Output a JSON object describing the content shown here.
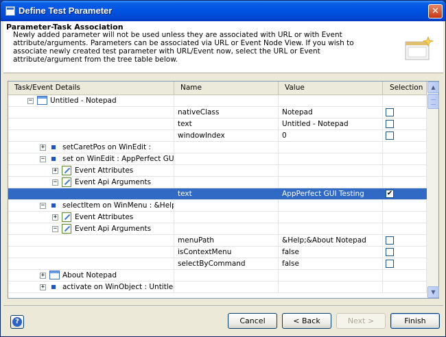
{
  "window": {
    "title": "Define Test Parameter",
    "close_glyph": "✕"
  },
  "header": {
    "title": "Parameter-Task Association",
    "description": "Newly added parameter will not be used unless they are associated with URL or with Event attribute/arguments. Parameters can be associated via URL or Event Node View. If you wish to associate newly created test parameter with URL/Event now, select the URL or Event attribute/argument from the tree table below.",
    "image_icon": "wizard-window-icon"
  },
  "table": {
    "columns": [
      "Task/Event Details",
      "Name",
      "Value",
      "Selection"
    ],
    "rows": [
      {
        "indent": 0,
        "toggle": "−",
        "icon": "window-icon",
        "task": "Untitled - Notepad",
        "name": "",
        "value": "",
        "checkbox": false,
        "checked": false,
        "selected": false
      },
      {
        "indent": -1,
        "toggle": "",
        "icon": "",
        "task": "",
        "name": "nativeClass",
        "value": "Notepad",
        "checkbox": true,
        "checked": false,
        "selected": false
      },
      {
        "indent": -1,
        "toggle": "",
        "icon": "",
        "task": "",
        "name": "text",
        "value": "Untitled - Notepad",
        "checkbox": true,
        "checked": false,
        "selected": false
      },
      {
        "indent": -1,
        "toggle": "",
        "icon": "",
        "task": "",
        "name": "windowIndex",
        "value": "0",
        "checkbox": true,
        "checked": false,
        "selected": false
      },
      {
        "indent": 1,
        "toggle": "+",
        "icon": "event-icon",
        "task": "setCaretPos on WinEdit :",
        "name": "",
        "value": "",
        "checkbox": false,
        "checked": false,
        "selected": false
      },
      {
        "indent": 1,
        "toggle": "−",
        "icon": "event-icon",
        "task": "set on WinEdit : AppPerfect GUI T",
        "name": "",
        "value": "",
        "checkbox": false,
        "checked": false,
        "selected": false
      },
      {
        "indent": 2,
        "toggle": "+",
        "icon": "edit-icon",
        "task": "Event Attributes",
        "name": "",
        "value": "",
        "checkbox": false,
        "checked": false,
        "selected": false
      },
      {
        "indent": 2,
        "toggle": "−",
        "icon": "edit-icon",
        "task": "Event Api Arguments",
        "name": "",
        "value": "",
        "checkbox": false,
        "checked": false,
        "selected": false
      },
      {
        "indent": -1,
        "toggle": "",
        "icon": "",
        "task": "",
        "name": "text",
        "value": "AppPerfect GUI Testing",
        "checkbox": true,
        "checked": true,
        "selected": true
      },
      {
        "indent": 1,
        "toggle": "−",
        "icon": "event-icon",
        "task": "selectItem on WinMenu : &Help;&",
        "name": "",
        "value": "",
        "checkbox": false,
        "checked": false,
        "selected": false
      },
      {
        "indent": 2,
        "toggle": "+",
        "icon": "edit-icon",
        "task": "Event Attributes",
        "name": "",
        "value": "",
        "checkbox": false,
        "checked": false,
        "selected": false
      },
      {
        "indent": 2,
        "toggle": "−",
        "icon": "edit-icon",
        "task": "Event Api Arguments",
        "name": "",
        "value": "",
        "checkbox": false,
        "checked": false,
        "selected": false
      },
      {
        "indent": -1,
        "toggle": "",
        "icon": "",
        "task": "",
        "name": "menuPath",
        "value": "&Help;&About Notepad",
        "checkbox": true,
        "checked": false,
        "selected": false
      },
      {
        "indent": -1,
        "toggle": "",
        "icon": "",
        "task": "",
        "name": "isContextMenu",
        "value": "false",
        "checkbox": true,
        "checked": false,
        "selected": false
      },
      {
        "indent": -1,
        "toggle": "",
        "icon": "",
        "task": "",
        "name": "selectByCommand",
        "value": "false",
        "checkbox": true,
        "checked": false,
        "selected": false
      },
      {
        "indent": 1,
        "toggle": "+",
        "icon": "window-icon",
        "task": "About Notepad",
        "name": "",
        "value": "",
        "checkbox": false,
        "checked": false,
        "selected": false
      },
      {
        "indent": 1,
        "toggle": "+",
        "icon": "event-icon",
        "task": "activate on WinObject : Untitled -",
        "name": "",
        "value": "",
        "checkbox": false,
        "checked": false,
        "selected": false
      }
    ],
    "scrollbar": {
      "up": "▲",
      "down": "▼"
    }
  },
  "buttons": {
    "help": "?",
    "cancel": "Cancel",
    "back": "< Back",
    "next": "Next >",
    "finish": "Finish"
  }
}
